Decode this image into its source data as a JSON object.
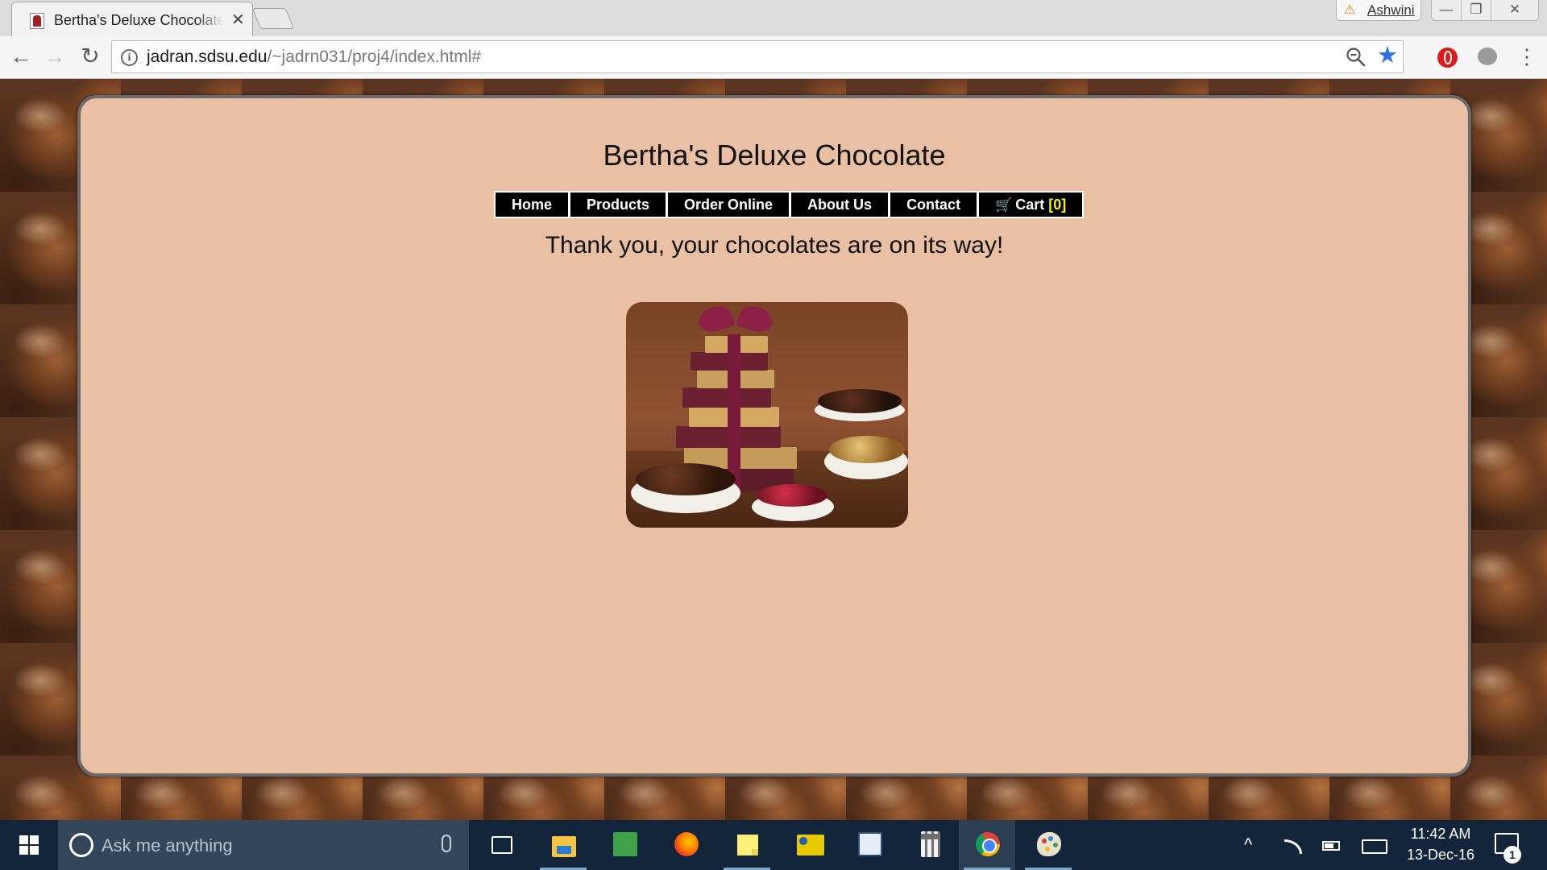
{
  "browser": {
    "tab": {
      "title": "Bertha's Deluxe Chocolate",
      "close_glyph": "✕",
      "favicon": "chocolate-favicon"
    },
    "profile": {
      "name": "Ashwini",
      "warning_glyph": "⚠"
    },
    "window_controls": {
      "minimize": "—",
      "maximize": "❐",
      "close": "✕"
    },
    "nav": {
      "back": "←",
      "forward": "→",
      "reload": "↻",
      "menu": "⋮"
    },
    "url": {
      "host": "jadran.sdsu.edu",
      "path": "/~jadrn031/proj4/index.html#",
      "info_glyph": "i"
    },
    "star_glyph": "★"
  },
  "page": {
    "title": "Bertha's Deluxe Chocolate",
    "nav": {
      "home": "Home",
      "products": "Products",
      "order_online": "Order Online",
      "about_us": "About Us",
      "contact": "Contact",
      "cart": "Cart",
      "cart_count": "[0]",
      "cart_glyph": "🛒"
    },
    "message": "Thank you, your chocolates are on its way!",
    "image": {
      "subject": "gift-tower-with-chocolates"
    },
    "colors": {
      "panel_bg": "#e9c0a4",
      "nav_bg": "#000000",
      "cart_count": "#f5f500"
    }
  },
  "taskbar": {
    "search_placeholder": "Ask me anything",
    "apps": [
      "task-view",
      "file-explorer",
      "notepad-plus",
      "firefox",
      "sticky-notes",
      "snipping-tool",
      "remote-desktop",
      "calculator",
      "chrome",
      "paint"
    ],
    "tray": {
      "chevron": "^"
    },
    "clock": {
      "time": "11:42 AM",
      "date": "13-Dec-16"
    },
    "notifications": "1"
  }
}
